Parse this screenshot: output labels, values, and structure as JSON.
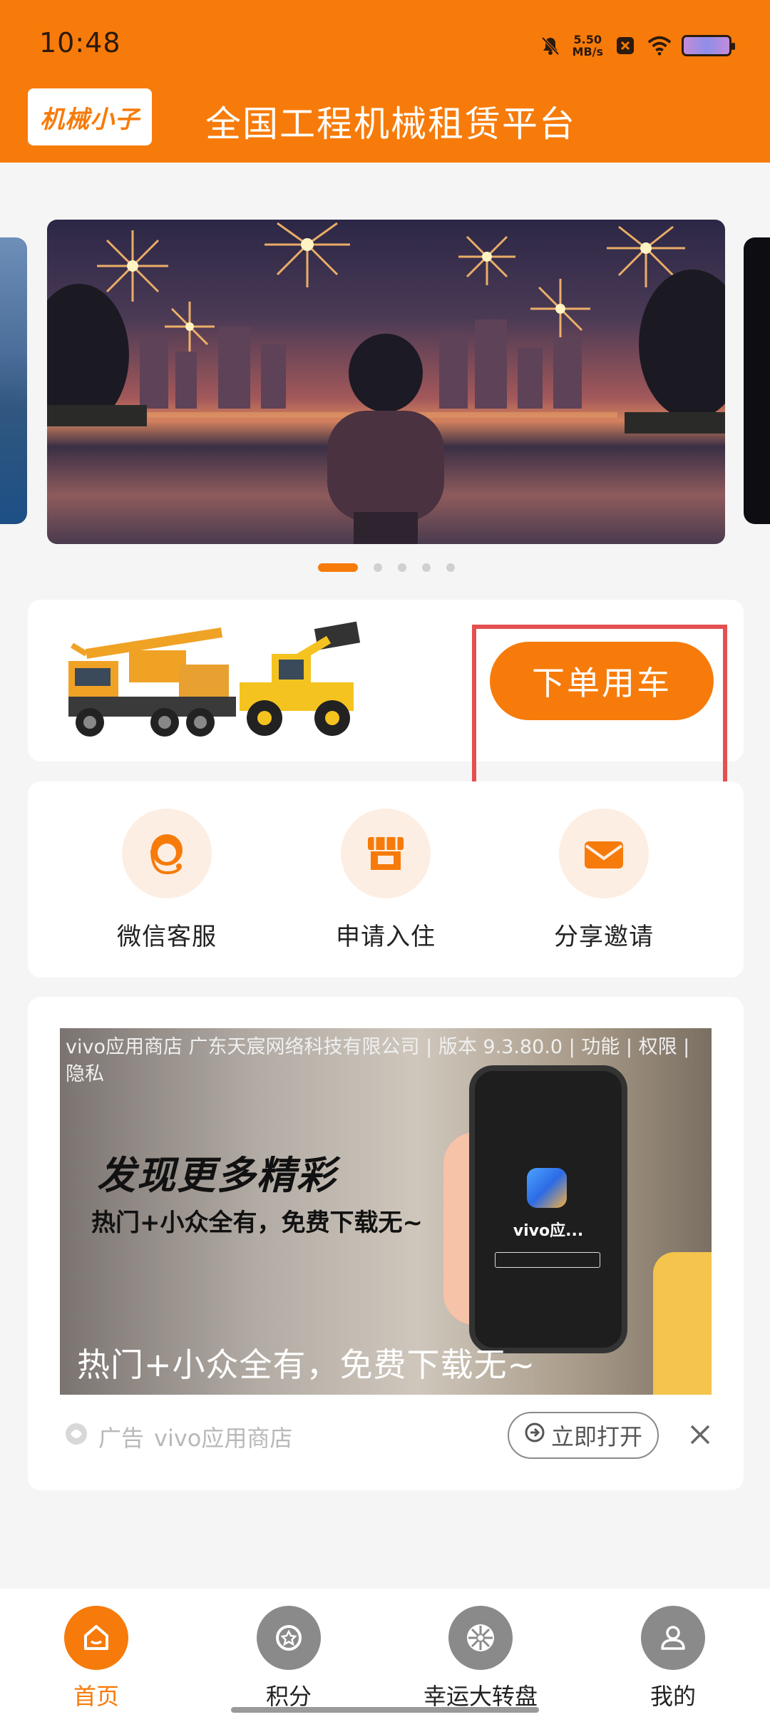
{
  "status_bar": {
    "time": "10:48",
    "net_speed_value": "5.50",
    "net_speed_unit": "MB/s"
  },
  "header": {
    "logo_text": "机械小子",
    "title": "全国工程机械租赁平台"
  },
  "order": {
    "button_label": "下单用车"
  },
  "quick_actions": [
    {
      "label": "微信客服",
      "icon": "customer-service-icon"
    },
    {
      "label": "申请入住",
      "icon": "store-icon"
    },
    {
      "label": "分享邀请",
      "icon": "envelope-icon"
    }
  ],
  "ad": {
    "meta": "vivo应用商店 广东天宸网络科技有限公司 | 版本 9.3.80.0 | 功能 | 权限 | 隐私",
    "headline": "发现更多精彩",
    "subline": "热门+小众全有，免费下载无~",
    "caption": "热门+小众全有，免费下载无~",
    "phone_app_label": "vivo应...",
    "source_tag": "广告",
    "source_name": "vivo应用商店",
    "open_button": "立即打开"
  },
  "bottom_nav": [
    {
      "label": "首页",
      "icon": "home-icon",
      "active": true
    },
    {
      "label": "积分",
      "icon": "star-icon",
      "active": false
    },
    {
      "label": "幸运大转盘",
      "icon": "wheel-icon",
      "active": false
    },
    {
      "label": "我的",
      "icon": "user-icon",
      "active": false
    }
  ],
  "colors": {
    "primary": "#f77b0a",
    "highlight_border": "#e4504f"
  },
  "carousel": {
    "active_index": 0,
    "count": 5
  }
}
